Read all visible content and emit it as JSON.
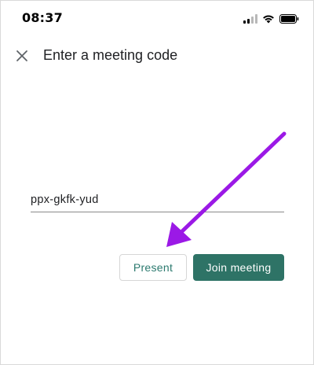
{
  "status_bar": {
    "time": "08:37",
    "icons": [
      "cellular-signal-icon",
      "wifi-icon",
      "battery-icon"
    ]
  },
  "header": {
    "close_icon": "close-icon",
    "title": "Enter a meeting code"
  },
  "meeting_code": {
    "value": "ppx-gkfk-yud",
    "placeholder": ""
  },
  "actions": {
    "present_label": "Present",
    "join_label": "Join meeting"
  },
  "colors": {
    "accent": "#2e7366",
    "accent_text": "#2c7a6f",
    "annotation_arrow": "#9b19e6"
  }
}
